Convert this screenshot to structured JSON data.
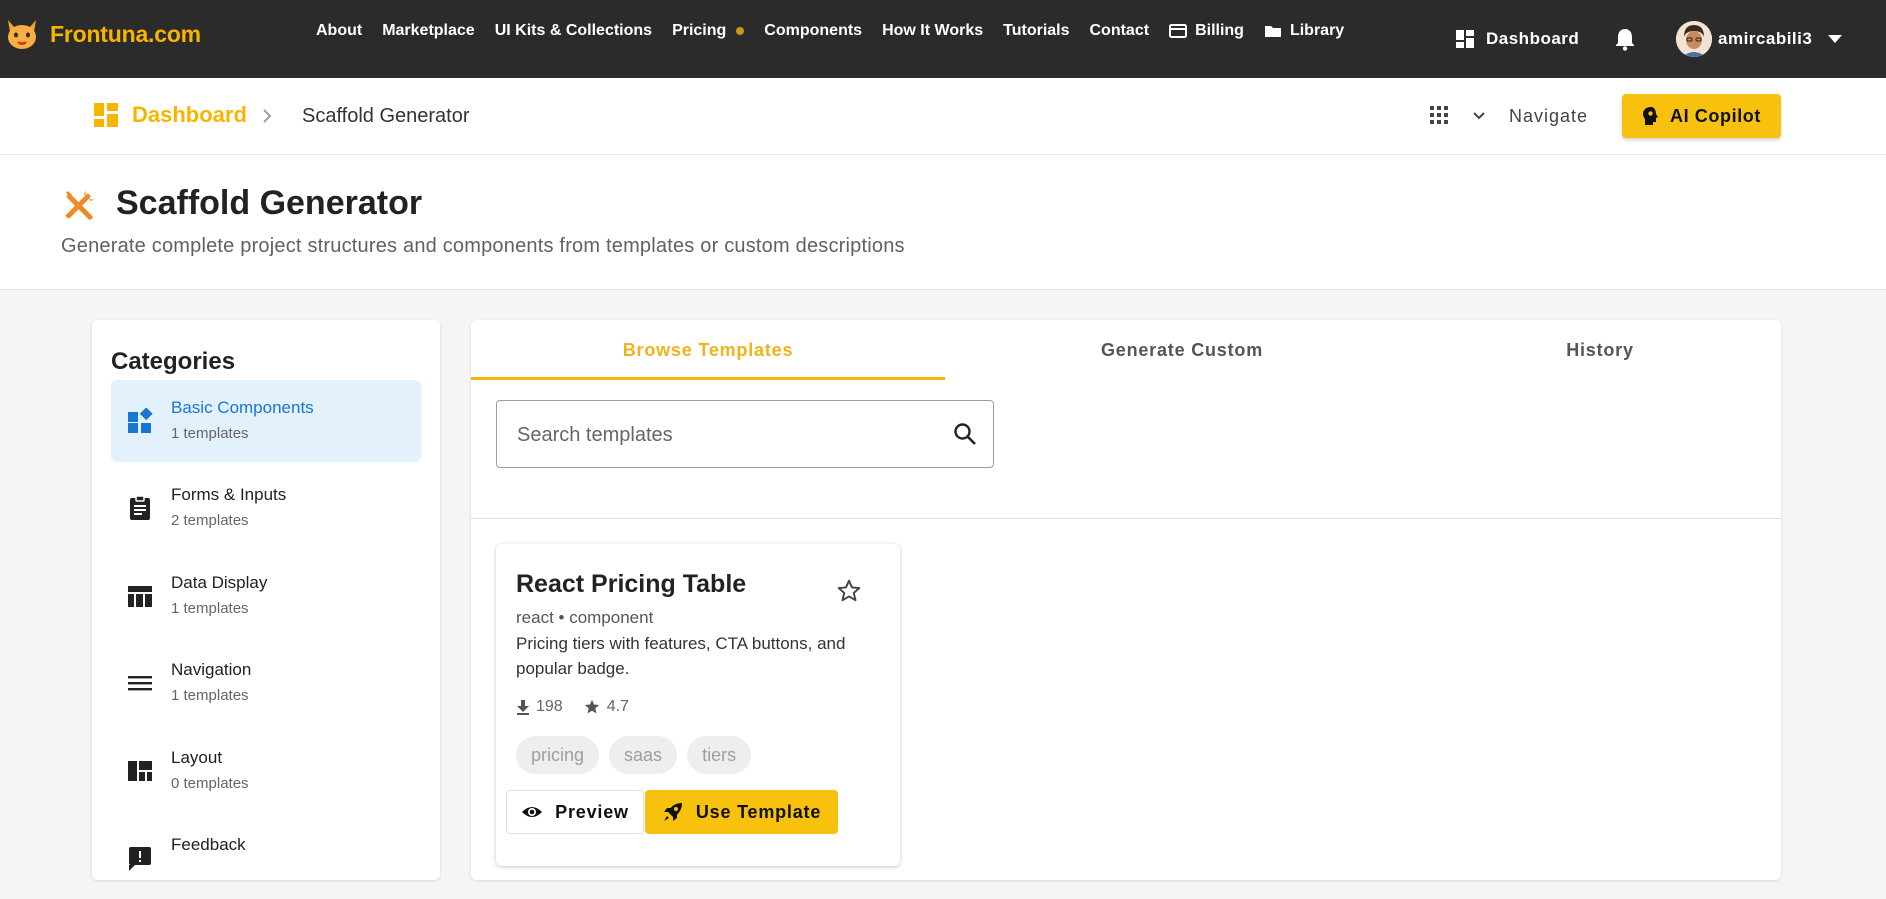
{
  "brand": {
    "name": "Frontuna.com",
    "logo_icon": "cat-logo-icon",
    "color": "#f7b500"
  },
  "nav": {
    "links": [
      "About",
      "Marketplace",
      "UI Kits & Collections",
      "Pricing",
      "Components",
      "How It Works",
      "Tutorials",
      "Contact",
      "Billing",
      "Library"
    ],
    "dashboard": "Dashboard",
    "username": "amircabili3"
  },
  "breadcrumb": {
    "root": "Dashboard",
    "separator": ">",
    "current": "Scaffold Generator",
    "navigate_label": "Navigate",
    "copilot_label": "AI Copilot"
  },
  "page": {
    "title": "Scaffold Generator",
    "subtitle": "Generate complete project structures and components from templates or custom descriptions"
  },
  "categories": {
    "title": "Categories",
    "items": [
      {
        "name": "Basic Components",
        "count": "1 templates",
        "icon": "widgets-icon",
        "active": true
      },
      {
        "name": "Forms & Inputs",
        "count": "2 templates",
        "icon": "clipboard-icon"
      },
      {
        "name": "Data Display",
        "count": "1 templates",
        "icon": "table-icon"
      },
      {
        "name": "Navigation",
        "count": "1 templates",
        "icon": "menu-icon"
      },
      {
        "name": "Layout",
        "count": "0 templates",
        "icon": "layout-icon"
      },
      {
        "name": "Feedback",
        "count": "",
        "icon": "feedback-icon"
      }
    ]
  },
  "tabs": [
    "Browse Templates",
    "Generate Custom",
    "History"
  ],
  "search": {
    "placeholder": "Search templates",
    "value": ""
  },
  "template_card": {
    "title": "React Pricing Table",
    "meta": "react • component",
    "description": "Pricing tiers with features, CTA buttons, and popular badge.",
    "downloads": "198",
    "rating": "4.7",
    "tags": [
      "pricing",
      "saas",
      "tiers"
    ],
    "preview_label": "Preview",
    "use_label": "Use Template"
  },
  "colors": {
    "accent": "#f7c10d",
    "active_blue": "#1976d2",
    "active_bg": "#e3f1fc",
    "topbar": "#2b2b2b"
  }
}
